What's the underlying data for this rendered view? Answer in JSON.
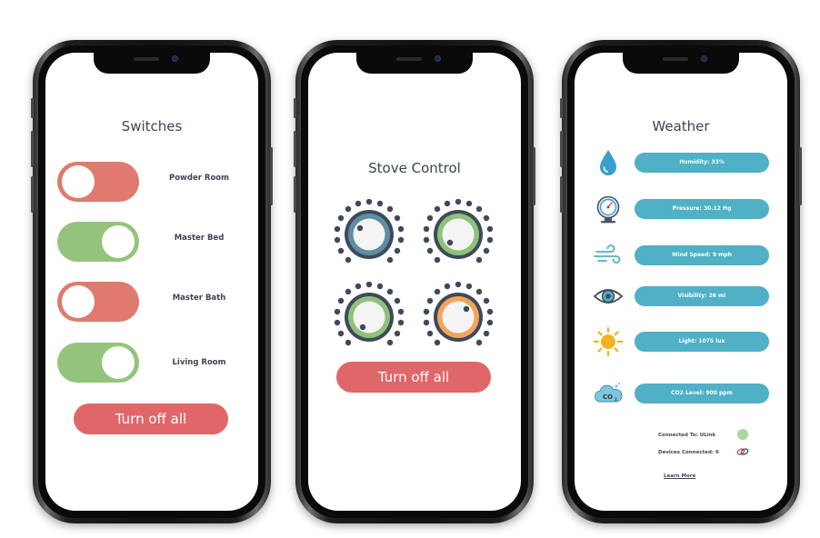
{
  "switches_screen": {
    "title": "Switches",
    "toggles": [
      {
        "label": "Powder Room",
        "state": "off"
      },
      {
        "label": "Master Bed",
        "state": "on"
      },
      {
        "label": "Master Bath",
        "state": "off"
      },
      {
        "label": "Living Room",
        "state": "on"
      }
    ],
    "turn_off_all_label": "Turn off all"
  },
  "stove_screen": {
    "title": "Stove Control",
    "knobs": [
      {
        "color": "#5e8ea2",
        "label": ""
      },
      {
        "color": "#8fc17a",
        "label": ""
      },
      {
        "color": "#8fc17a",
        "label": ""
      },
      {
        "color": "#f2a45d",
        "label": ""
      }
    ],
    "turn_off_all_label": "Turn off all"
  },
  "weather_screen": {
    "title": "Weather",
    "readings": [
      {
        "icon": "water-drop-icon",
        "text": "Humidity: 33%"
      },
      {
        "icon": "barometer-icon",
        "text": "Pressure: 30.12 Hg"
      },
      {
        "icon": "wind-icon",
        "text": "Wind Speed: 9 mph"
      },
      {
        "icon": "eye-icon",
        "text": "Visibility: 26 mi"
      },
      {
        "icon": "sun-icon",
        "text": "Light: 1075 lux"
      },
      {
        "icon": "co2-cloud-icon",
        "text": "CO2 Level: 900 ppm"
      }
    ],
    "connected_to": "Connected To: ULink",
    "devices_connected": "Devices Connected: 6",
    "learn_more": "Learn More"
  },
  "colors": {
    "toggle_off": "#e07a6e",
    "toggle_on": "#94c47c",
    "button_red": "#e0666a",
    "weather_pill": "#4fb0c6",
    "status_dot": "#a9d7a0"
  }
}
